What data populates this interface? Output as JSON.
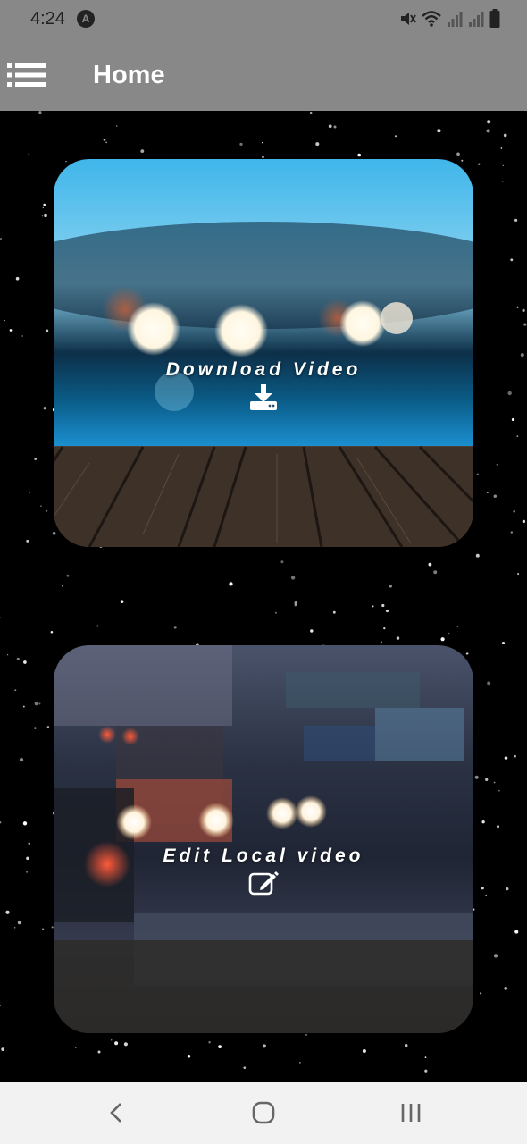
{
  "status_bar": {
    "time": "4:24",
    "app_icon": "notification-app-icon",
    "icons": [
      "mute-icon",
      "wifi-icon",
      "signal-icon",
      "signal-icon",
      "battery-icon"
    ]
  },
  "app_bar": {
    "menu_icon": "menu-list-icon",
    "title": "Home"
  },
  "cards": {
    "download": {
      "label": "Download Video",
      "icon": "download-icon"
    },
    "edit": {
      "label": "Edit Local video",
      "icon": "edit-icon"
    }
  },
  "nav_bar": {
    "icons": [
      "back-icon",
      "home-icon",
      "recents-icon"
    ]
  },
  "colors": {
    "app_bar": "#888888",
    "background": "#000000",
    "nav_bar": "#f2f2f2"
  }
}
